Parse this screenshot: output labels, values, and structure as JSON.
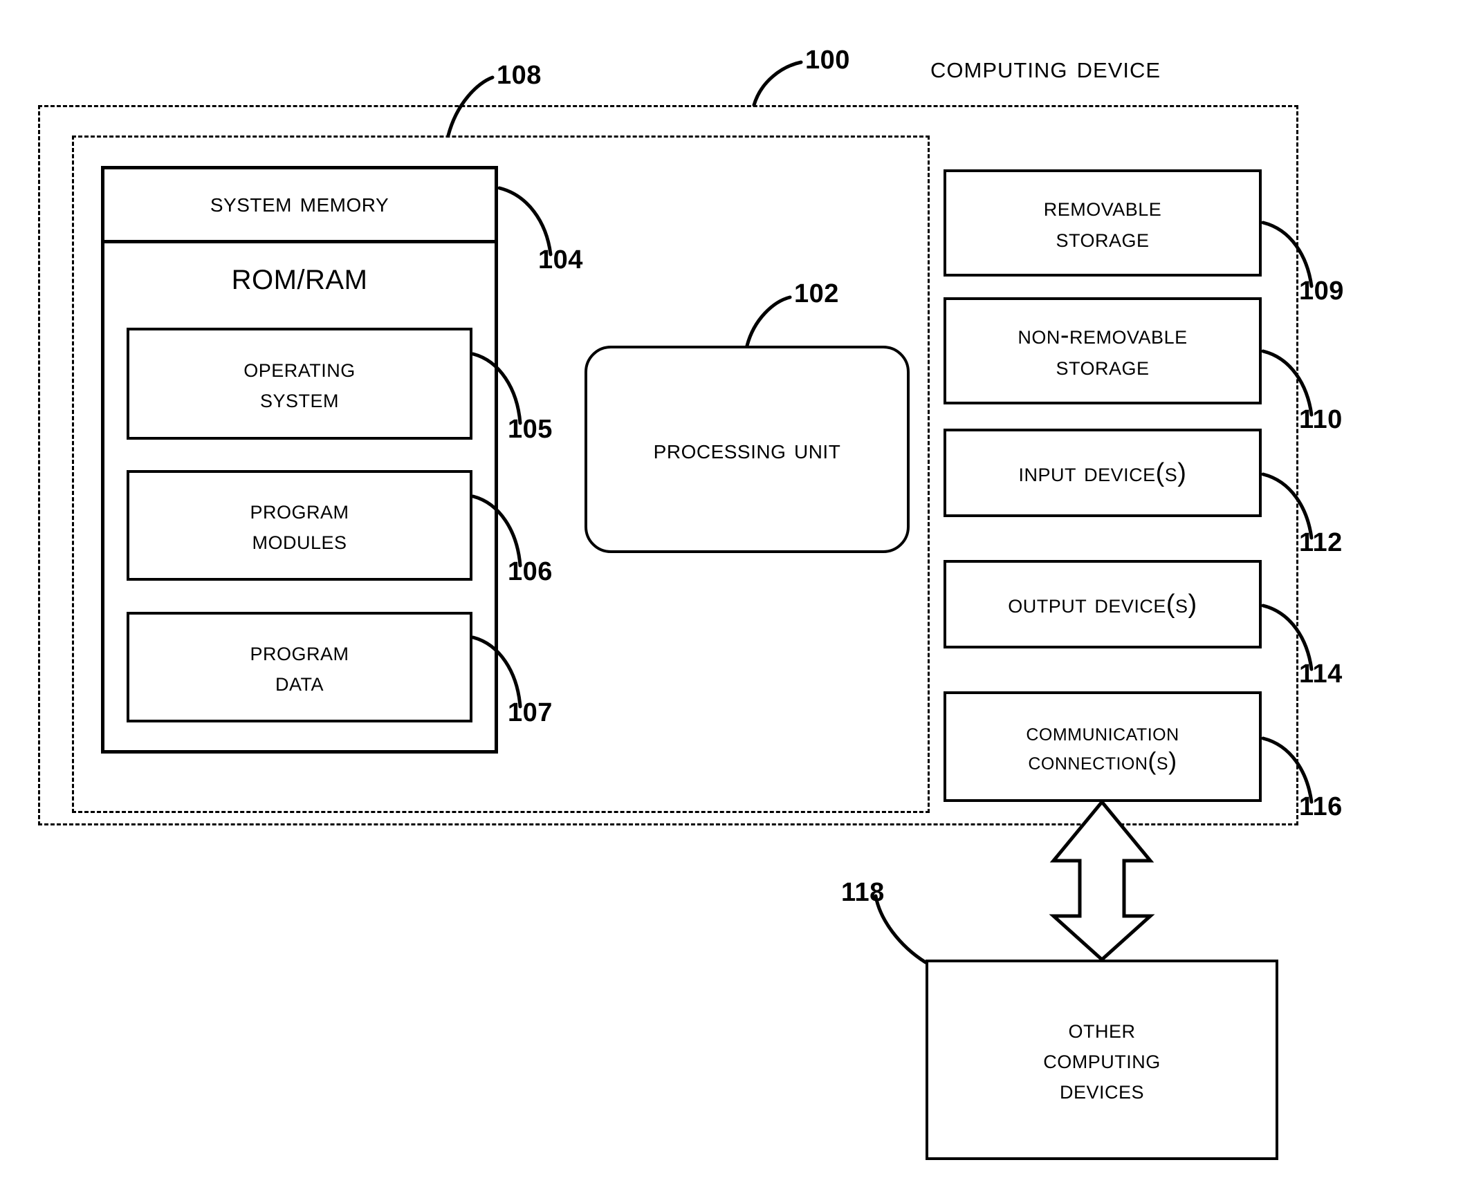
{
  "figure": {
    "title": "Computing Device",
    "outer_ref": "100",
    "inner_ref": "108"
  },
  "memory": {
    "header": "System Memory",
    "header_ref": "104",
    "rom_ram": "ROM/RAM",
    "items": [
      {
        "line1": "Operating",
        "line2": "System",
        "ref": "105"
      },
      {
        "line1": "Program",
        "line2": "Modules",
        "ref": "106"
      },
      {
        "line1": "Program",
        "line2": "Data",
        "ref": "107"
      }
    ]
  },
  "processing_unit": {
    "label": "Processing Unit",
    "ref": "102"
  },
  "peripherals": [
    {
      "line1": "Removable",
      "line2": "Storage",
      "ref": "109"
    },
    {
      "line1": "Non-Removable",
      "line2": "Storage",
      "ref": "110"
    },
    {
      "line1": "Input Device(s)",
      "line2": "",
      "ref": "112"
    },
    {
      "line1": "Output Device(s)",
      "line2": "",
      "ref": "114"
    },
    {
      "line1": "Communication",
      "line2": "Connection(s)",
      "ref": "116"
    }
  ],
  "external": {
    "line1": "Other",
    "line2": "Computing",
    "line3": "Devices",
    "ref": "118"
  },
  "colors": {
    "ink": "#000000",
    "paper": "#ffffff"
  }
}
